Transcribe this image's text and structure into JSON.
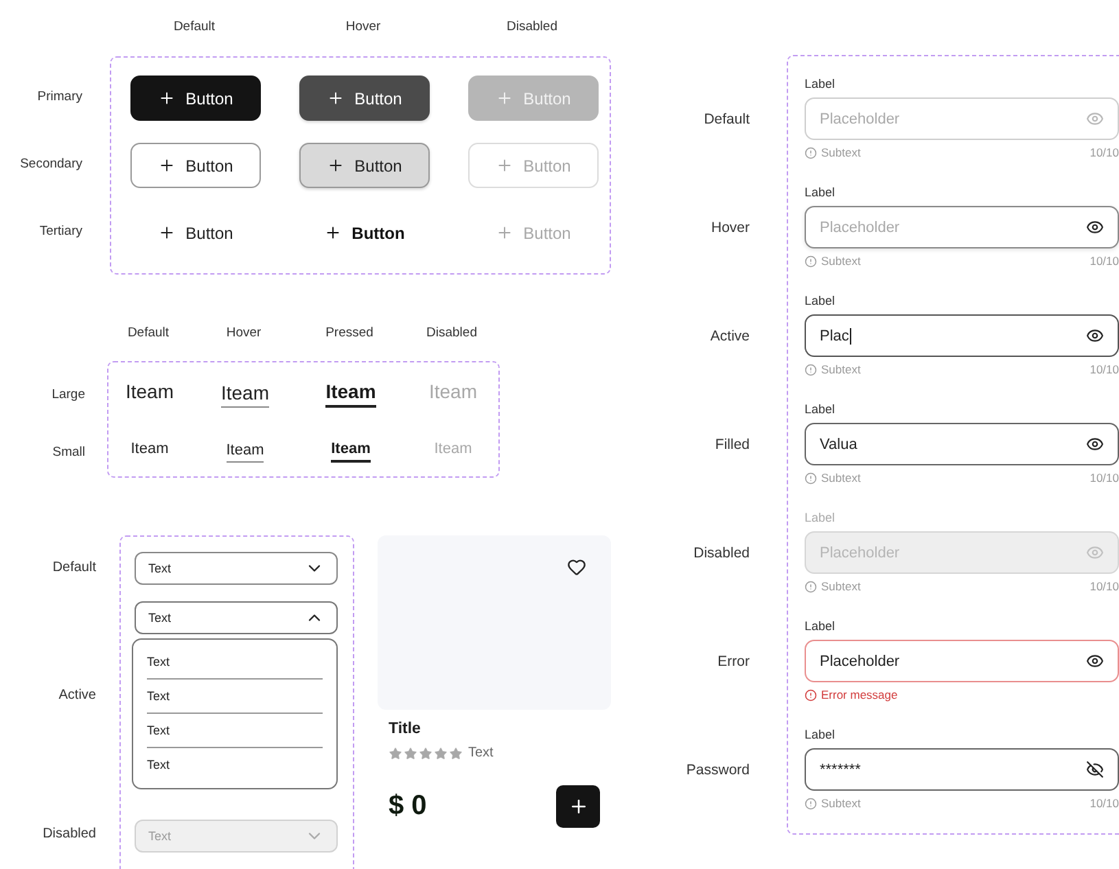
{
  "buttons": {
    "columns": [
      "Default",
      "Hover",
      "Disabled"
    ],
    "rows": [
      {
        "label": "Primary",
        "kind": "primary",
        "items": [
          {
            "label": "Button",
            "hovered": false,
            "disabled": false
          },
          {
            "label": "Button",
            "hovered": true,
            "disabled": false
          },
          {
            "label": "Button",
            "hovered": false,
            "disabled": true
          }
        ]
      },
      {
        "label": "Secondary",
        "kind": "secondary",
        "items": [
          {
            "label": "Button",
            "hovered": false,
            "disabled": false
          },
          {
            "label": "Button",
            "hovered": true,
            "disabled": false
          },
          {
            "label": "Button",
            "hovered": false,
            "disabled": true
          }
        ]
      },
      {
        "label": "Tertiary",
        "kind": "tertiary",
        "items": [
          {
            "label": "Button",
            "hovered": false,
            "disabled": false
          },
          {
            "label": "Button",
            "hovered": true,
            "disabled": false
          },
          {
            "label": "Button",
            "hovered": false,
            "disabled": true
          }
        ]
      }
    ]
  },
  "nav_items": {
    "columns": [
      "Default",
      "Hover",
      "Pressed",
      "Disabled"
    ],
    "rows": [
      {
        "label": "Large",
        "kind": "large",
        "items": [
          {
            "label": "Iteam",
            "hovered": false,
            "pressed": false,
            "disabled": false
          },
          {
            "label": "Iteam",
            "hovered": true,
            "pressed": false,
            "disabled": false
          },
          {
            "label": "Iteam",
            "hovered": false,
            "pressed": true,
            "disabled": false
          },
          {
            "label": "Iteam",
            "hovered": false,
            "pressed": false,
            "disabled": true
          }
        ]
      },
      {
        "label": "Small",
        "kind": "small",
        "items": [
          {
            "label": "Iteam",
            "hovered": false,
            "pressed": false,
            "disabled": false
          },
          {
            "label": "Iteam",
            "hovered": true,
            "pressed": false,
            "disabled": false
          },
          {
            "label": "Iteam",
            "hovered": false,
            "pressed": true,
            "disabled": false
          },
          {
            "label": "Iteam",
            "hovered": false,
            "pressed": false,
            "disabled": true
          }
        ]
      }
    ]
  },
  "dropdowns": [
    {
      "label": "Default",
      "value": "Text",
      "expanded": false,
      "disabled": false
    },
    {
      "label": "Active",
      "value": "Text",
      "expanded": true,
      "disabled": false,
      "options": [
        "Text",
        "Text",
        "Text",
        "Text"
      ]
    },
    {
      "label": "Disabled",
      "value": "Text",
      "expanded": false,
      "disabled": true
    }
  ],
  "product_card": {
    "favorited": false,
    "title": "Title",
    "stars": 0,
    "rating_text": "Text",
    "price": "$ 0"
  },
  "text_fields": [
    {
      "row_label": "Default",
      "kind": "text",
      "hovered": false,
      "focused": false,
      "disabled": false,
      "label": "Label",
      "placeholder": "Placeholder",
      "subtext": "Subtext",
      "counter": "10/10"
    },
    {
      "row_label": "Hover",
      "kind": "text",
      "hovered": true,
      "focused": false,
      "disabled": false,
      "label": "Label",
      "placeholder": "Placeholder",
      "subtext": "Subtext",
      "counter": "10/10"
    },
    {
      "row_label": "Active",
      "kind": "text",
      "hovered": false,
      "focused": true,
      "disabled": false,
      "label": "Label",
      "value": "Plac",
      "subtext": "Subtext",
      "counter": "10/10"
    },
    {
      "row_label": "Filled",
      "kind": "text",
      "hovered": false,
      "focused": false,
      "disabled": false,
      "label": "Label",
      "value": "Valua",
      "subtext": "Subtext",
      "counter": "10/10"
    },
    {
      "row_label": "Disabled",
      "kind": "text",
      "hovered": false,
      "focused": false,
      "disabled": true,
      "label": "Label",
      "placeholder": "Placeholder",
      "subtext": "Subtext",
      "counter": "10/10"
    },
    {
      "row_label": "Error",
      "kind": "text",
      "hovered": false,
      "focused": false,
      "disabled": false,
      "label": "Label",
      "value": "Placeholder",
      "error": "Error message"
    },
    {
      "row_label": "Password",
      "kind": "password",
      "hovered": false,
      "focused": false,
      "disabled": false,
      "label": "Label",
      "value": "*******",
      "subtext": "Subtext",
      "counter": "10/10"
    }
  ]
}
